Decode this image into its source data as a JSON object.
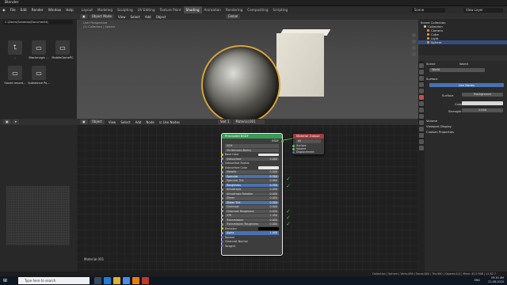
{
  "window_title": "Blender",
  "menubar": {
    "menus": [
      "File",
      "Edit",
      "Render",
      "Window",
      "Help"
    ],
    "workspaces": [
      "Layout",
      "Modeling",
      "Sculpting",
      "UV Editing",
      "Texture Paint",
      "Shading",
      "Animation",
      "Rendering",
      "Compositing",
      "Scripting"
    ],
    "active_workspace": "Shading",
    "scene": "Scene",
    "view_layer": "View Layer"
  },
  "file_browser": {
    "path": "C:\\Users\\Sandeep\\Documents\\",
    "items": [
      {
        "label": "..",
        "icon": "folder-up-icon"
      },
      {
        "label": "Blackmagic ...",
        "icon": "folder-icon"
      },
      {
        "label": "MobileGamePC",
        "icon": "folder-icon"
      },
      {
        "label": "Saved record...",
        "icon": "folder-icon"
      },
      {
        "label": "Substance Pa...",
        "icon": "folder-icon"
      }
    ]
  },
  "viewport": {
    "mode": "Object Mode",
    "menus": [
      "View",
      "Select",
      "Add",
      "Object"
    ],
    "orientation": "Global",
    "info_line1": "User Perspective",
    "info_line2": "(1) Collection | Sphere"
  },
  "outliner": {
    "root": "Scene Collection",
    "items": [
      {
        "label": "Collection",
        "color": "#cccccc",
        "selected": false
      },
      {
        "label": "Camera",
        "color": "#e8a03a",
        "selected": false
      },
      {
        "label": "Cube",
        "color": "#e8a03a",
        "selected": false
      },
      {
        "label": "Light",
        "color": "#e8a03a",
        "selected": false
      },
      {
        "label": "Sphere",
        "color": "#e8a03a",
        "selected": true
      }
    ]
  },
  "properties": {
    "scene_label": "Scene",
    "world_label": "World",
    "world_name": "World",
    "surface_label": "Surface",
    "use_nodes_label": "Use Nodes",
    "surface_field_label": "Surface",
    "surface_value": "Background",
    "color_label": "Color",
    "strength_label": "Strength",
    "strength_value": "1.000",
    "panels": [
      "Volume",
      "Viewport Display",
      "Custom Properties"
    ]
  },
  "node_editor": {
    "editor_menus": [
      "Object",
      "View",
      "Select",
      "Add",
      "Node"
    ],
    "use_nodes_label": "Use Nodes",
    "slot": "Slot 1",
    "material": "Material.001",
    "material_footer": "Material.001",
    "bsdf_node": {
      "title": "Principled BSDF",
      "output": "BSDF",
      "distribution": "GGX",
      "subsurface_method": "Christensen-Burley",
      "rows": [
        {
          "label": "Base Color",
          "value": "",
          "style": "color"
        },
        {
          "label": "Subsurface",
          "value": "0.000",
          "style": "bar"
        },
        {
          "label": "Subsurface Radius",
          "value": "",
          "style": "plain"
        },
        {
          "label": "Subsurface Color",
          "value": "",
          "style": "color"
        },
        {
          "label": "Metallic",
          "value": "0.000",
          "style": "bar"
        },
        {
          "label": "Specular",
          "value": "0.500",
          "style": "blue"
        },
        {
          "label": "Specular Tint",
          "value": "0.000",
          "style": "bar"
        },
        {
          "label": "Roughness",
          "value": "0.500",
          "style": "blue"
        },
        {
          "label": "Anisotropic",
          "value": "0.000",
          "style": "bar"
        },
        {
          "label": "Anisotropic Rotation",
          "value": "0.000",
          "style": "bar"
        },
        {
          "label": "Sheen",
          "value": "0.000",
          "style": "bar"
        },
        {
          "label": "Sheen Tint",
          "value": "0.500",
          "style": "blue"
        },
        {
          "label": "Clearcoat",
          "value": "0.000",
          "style": "bar"
        },
        {
          "label": "Clearcoat Roughness",
          "value": "0.030",
          "style": "bar"
        },
        {
          "label": "IOR",
          "value": "1.450",
          "style": "bar"
        },
        {
          "label": "Transmission",
          "value": "0.000",
          "style": "bar"
        },
        {
          "label": "Transmission Roughness",
          "value": "0.000",
          "style": "bar"
        },
        {
          "label": "Emission",
          "value": "",
          "style": "dark"
        },
        {
          "label": "Alpha",
          "value": "1.000",
          "style": "blue"
        },
        {
          "label": "Normal",
          "value": "",
          "style": "plain"
        },
        {
          "label": "Clearcoat Normal",
          "value": "",
          "style": "plain"
        },
        {
          "label": "Tangent",
          "value": "",
          "style": "plain"
        }
      ]
    },
    "output_node": {
      "title": "Material Output",
      "target": "All",
      "inputs": [
        "Surface",
        "Volume",
        "Displacement"
      ]
    }
  },
  "statusbar": "Collection | Sphere | Verts:498 | Faces:480 | Tris:960 | Objects:1/3 | Mem: 40.5 MiB | v2.82.7",
  "taskbar": {
    "search_placeholder": "Type here to search",
    "time": "09:30 AM",
    "date": "22-08-2020",
    "lang": "ENG"
  }
}
